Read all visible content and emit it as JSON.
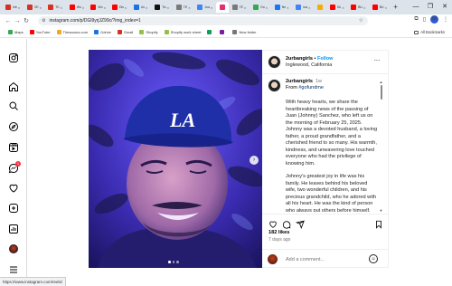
{
  "browser": {
    "tabs": [
      {
        "label": "Inb",
        "icon": "gmail-icon",
        "color": "#d93025"
      },
      {
        "label": "OE",
        "icon": "gmail-icon",
        "color": "#d93025"
      },
      {
        "label": "TK",
        "icon": "gmail-icon",
        "color": "#d93025"
      },
      {
        "label": "Wo",
        "icon": "youtube-icon",
        "color": "#ff0000"
      },
      {
        "label": "Wo",
        "icon": "youtube-icon",
        "color": "#ff0000"
      },
      {
        "label": "Dis",
        "icon": "youtube-icon",
        "color": "#ff0000"
      },
      {
        "label": "Un",
        "icon": "site-icon",
        "color": "#1a73e8"
      },
      {
        "label": "Tic",
        "icon": "tiktok-icon",
        "color": "#111111"
      },
      {
        "label": "TE",
        "icon": "site-icon",
        "color": "#7a7a7a"
      },
      {
        "label": "Jua",
        "icon": "google-icon",
        "color": "#4285f4"
      },
      {
        "label": "",
        "icon": "instagram-icon",
        "color": "#e1306c",
        "active": true
      },
      {
        "label": "TE",
        "icon": "site-icon",
        "color": "#7a7a7a"
      },
      {
        "label": "Go",
        "icon": "google-drive-icon",
        "color": "#34a853"
      },
      {
        "label": "Ne",
        "icon": "facebook-icon",
        "color": "#1877f2"
      },
      {
        "label": "Isa",
        "icon": "google-icon",
        "color": "#4285f4"
      },
      {
        "label": "",
        "icon": "site-icon",
        "color": "#f9ab00"
      },
      {
        "label": "BU",
        "icon": "youtube-icon",
        "color": "#ff0000"
      },
      {
        "label": "BU",
        "icon": "youtube-icon",
        "color": "#ff0000"
      },
      {
        "label": "BU",
        "icon": "youtube-icon",
        "color": "#ff0000"
      }
    ],
    "new_tab": "+",
    "window_controls": {
      "minimize": "—",
      "maximize": "❐",
      "close": "✕"
    },
    "url": "instagram.com/p/DGl9yrjJZ99c/?img_index=1",
    "profile_initial": "M",
    "bookmarks": [
      {
        "label": "Maps",
        "color": "#34a853"
      },
      {
        "label": "YouTube",
        "color": "#ff0000"
      },
      {
        "label": "Thesaurus.com",
        "color": "#f5a623"
      },
      {
        "label": "Gdrive",
        "color": "#1a73e8"
      },
      {
        "label": "Gmail",
        "color": "#d93025"
      },
      {
        "label": "Shopify",
        "color": "#95bf47"
      },
      {
        "label": "Shopify work sheet",
        "color": "#95bf47"
      },
      {
        "label": "",
        "color": "#0f9d58"
      },
      {
        "label": "",
        "color": "#7b1fa2"
      },
      {
        "label": "New folder",
        "color": "#777777"
      }
    ],
    "all_bookmarks": "All Bookmarks"
  },
  "sidebar": {
    "notification_count": "1"
  },
  "post": {
    "username": "2urbangirls",
    "separator": "•",
    "follow_label": "Follow",
    "location": "Inglewood, California",
    "more": "···",
    "caption": {
      "username": "2urbangirls",
      "ago": "1w",
      "from_prefix": "From ",
      "hashtag": "#gofundme",
      "paragraphs": [
        "With heavy hearts, we share the heartbreaking news of the passing of Juan (Johnny) Sanchez, who left us on the morning of February 25, 2025. Johnny was a devoted husband, a loving father, a proud grandfather, and a cherished friend to so many. His warmth, kindness, and unwavering love touched everyone who had the privilege of knowing him.",
        "Johnny's greatest joy in life was his family. He leaves behind his beloved wife, two wonderful children, and his precious grandchild, who he adored with all his heart. He was the kind of person who always put others before himself, offering help, a kind word, or"
      ]
    },
    "likes": "182 likes",
    "posted_ago": "7 days ago",
    "comment_placeholder": "Add a comment...",
    "image_count": 3,
    "current_image": 1
  },
  "status_bar_url": "https://www.instagram.com/reels/"
}
